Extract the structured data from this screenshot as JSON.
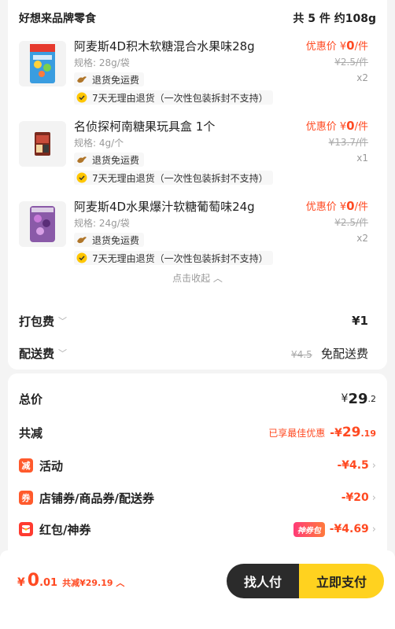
{
  "store": {
    "name": "好想来品牌零食",
    "summary": "共 5 件  约108g"
  },
  "items": [
    {
      "name": "阿麦斯4D积木软糖混合水果味28g",
      "spec": "规格: 28g/袋",
      "price_label": "优惠价 ¥0/件",
      "price_prefix": "优惠价 ¥",
      "price_value": "0",
      "price_suffix": "/件",
      "original_price": "¥2.5/件",
      "quantity": "x2",
      "tag_return": "退货免运费",
      "tag_7day": "7天无理由退货（一次性包装拆封不支持）"
    },
    {
      "name": "名侦探柯南糖果玩具盒 1个",
      "spec": "规格: 4g/个",
      "price_prefix": "优惠价 ¥",
      "price_value": "0",
      "price_suffix": "/件",
      "original_price": "¥13.7/件",
      "quantity": "x1",
      "tag_return": "退货免运费",
      "tag_7day": "7天无理由退货（一次性包装拆封不支持）"
    },
    {
      "name": "阿麦斯4D水果爆汁软糖葡萄味24g",
      "spec": "规格: 24g/袋",
      "price_prefix": "优惠价 ¥",
      "price_value": "0",
      "price_suffix": "/件",
      "original_price": "¥2.5/件",
      "quantity": "x2",
      "tag_return": "退货免运费",
      "tag_7day": "7天无理由退货（一次性包装拆封不支持）"
    }
  ],
  "collapse_label": "点击收起 ︿",
  "fees": {
    "packing_label": "打包费",
    "packing_value": "¥1",
    "delivery_label": "配送费",
    "delivery_original": "¥4.5",
    "delivery_value": "免配送费"
  },
  "summary": {
    "total_label": "总价",
    "total_currency": "¥",
    "total_int": "29",
    "total_dec": ".2",
    "reduce_label": "共减",
    "reduce_note": "已享最佳优惠",
    "reduce_prefix": "-¥",
    "reduce_int": "29",
    "reduce_dec": ".19",
    "activity_badge": "减",
    "activity_label": "活动",
    "activity_value": "-¥4.5",
    "coupon_badge": "券",
    "coupon_label": "店铺券/商品券/配送券",
    "coupon_value": "-¥20",
    "redpacket_label": "红包/神券",
    "redpacket_tag": "神券包",
    "redpacket_value": "-¥4.69"
  },
  "bottom": {
    "currency": "¥",
    "pay_int": "0",
    "pay_dec": ".01",
    "save_text": "共减¥29.19 ︿",
    "friend_button": "找人付",
    "pay_button": "立即支付"
  },
  "colors": {
    "accent": "#ff4a22",
    "pay_button": "#ffd21f",
    "friend_button": "#2b2b2b"
  }
}
